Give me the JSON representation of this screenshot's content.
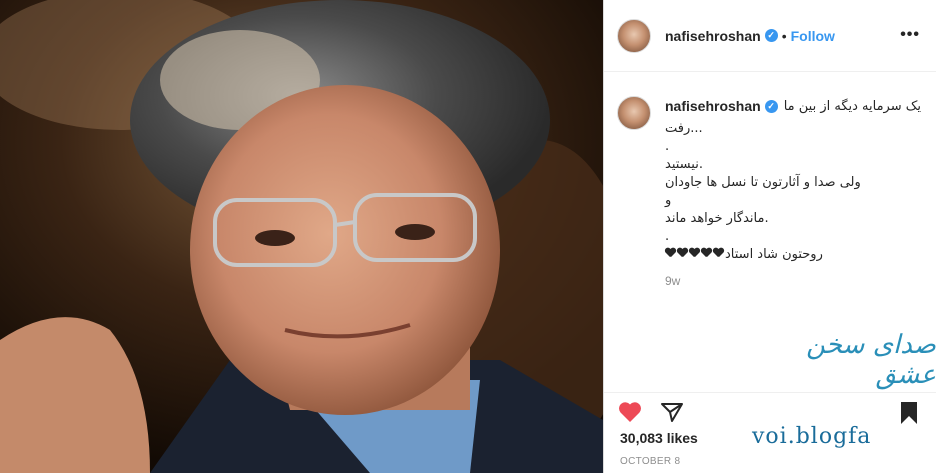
{
  "header": {
    "username": "nafisehroshan",
    "separator": "•",
    "follow_label": "Follow",
    "more_label": "•••"
  },
  "caption": {
    "username": "nafisehroshan",
    "line1": "یک سرمایه دیگه از بین ما",
    "lines": [
      "رفت...",
      ".",
      "نیستید.",
      "ولی صدا و آثارتون تا نسل ها جاودان",
      "و",
      "ماندگار خواهد ماند.",
      "."
    ],
    "last_line": "روحتون شاد استاد",
    "time": "9w"
  },
  "watermark": {
    "title": "صدای سخن عشق",
    "url": "voi.blogfa"
  },
  "footer": {
    "likes": "30,083 likes",
    "date": "OCTOBER 8"
  },
  "icons": {
    "like": "heart-icon",
    "share": "paper-plane-icon",
    "save": "bookmark-icon",
    "verified": "verified-badge-icon"
  },
  "colors": {
    "accent": "#3897f0",
    "like": "#ed4956",
    "watermark": "#2a8fb8"
  }
}
